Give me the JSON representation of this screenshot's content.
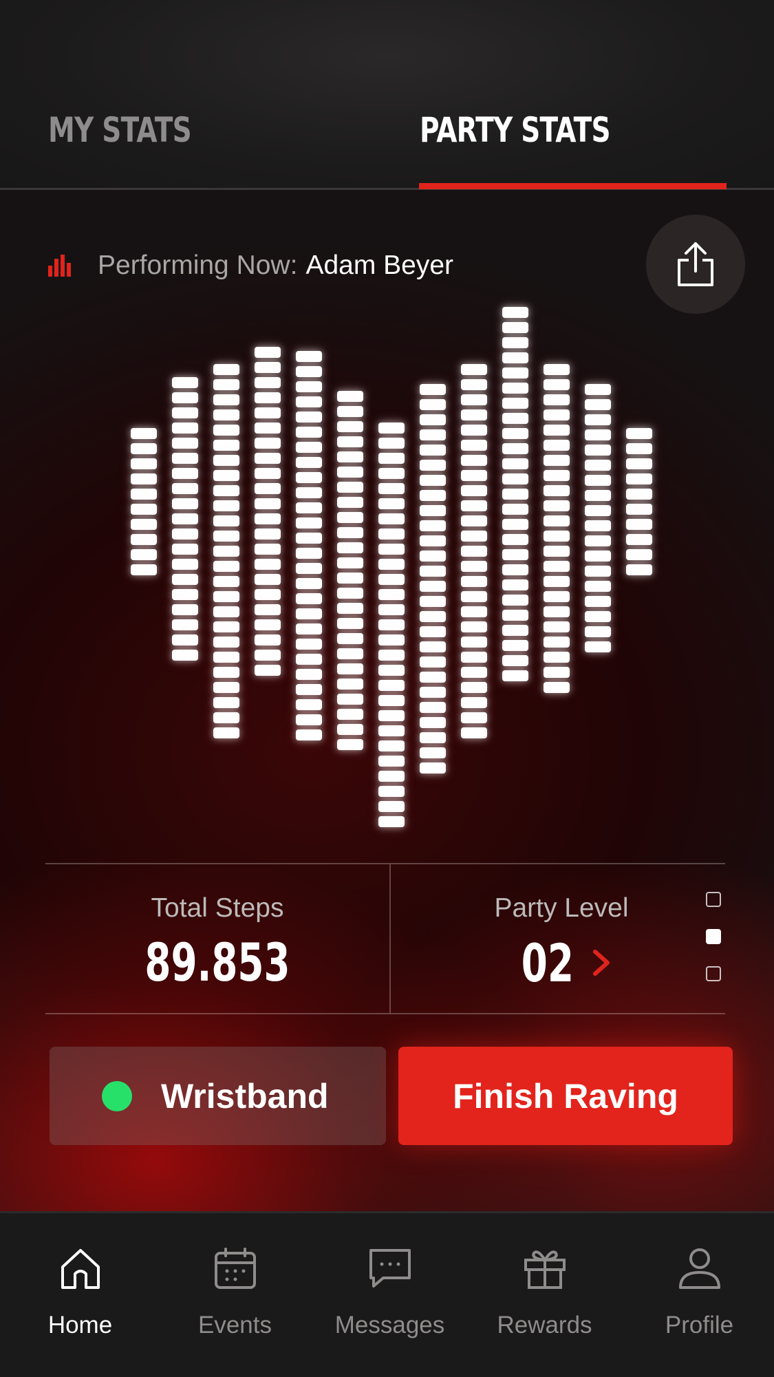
{
  "tabs": [
    {
      "label": "MY STATS",
      "active": false
    },
    {
      "label": "PARTY STATS",
      "active": true
    }
  ],
  "performing": {
    "label": "Performing Now:",
    "artist": "Adam Beyer",
    "icon": "equalizer-icon",
    "share_icon": "share-icon"
  },
  "stats": {
    "steps_label": "Total Steps",
    "steps_value": "89.853",
    "level_label": "Party Level",
    "level_value": "02",
    "level_icon": "chevron-right-icon",
    "pager_pages": 3,
    "pager_active": 2
  },
  "buttons": {
    "wristband": "Wristband",
    "finish": "Finish Raving"
  },
  "nav": [
    {
      "label": "Home",
      "icon": "home-icon",
      "active": true
    },
    {
      "label": "Events",
      "icon": "calendar-icon",
      "active": false
    },
    {
      "label": "Messages",
      "icon": "message-icon",
      "active": false
    },
    {
      "label": "Rewards",
      "icon": "gift-icon",
      "active": false
    },
    {
      "label": "Profile",
      "icon": "profile-icon",
      "active": false
    }
  ],
  "colors": {
    "accent": "#e0241c",
    "status_connected": "#27e06a",
    "inactive_text": "#8f8c8c"
  }
}
